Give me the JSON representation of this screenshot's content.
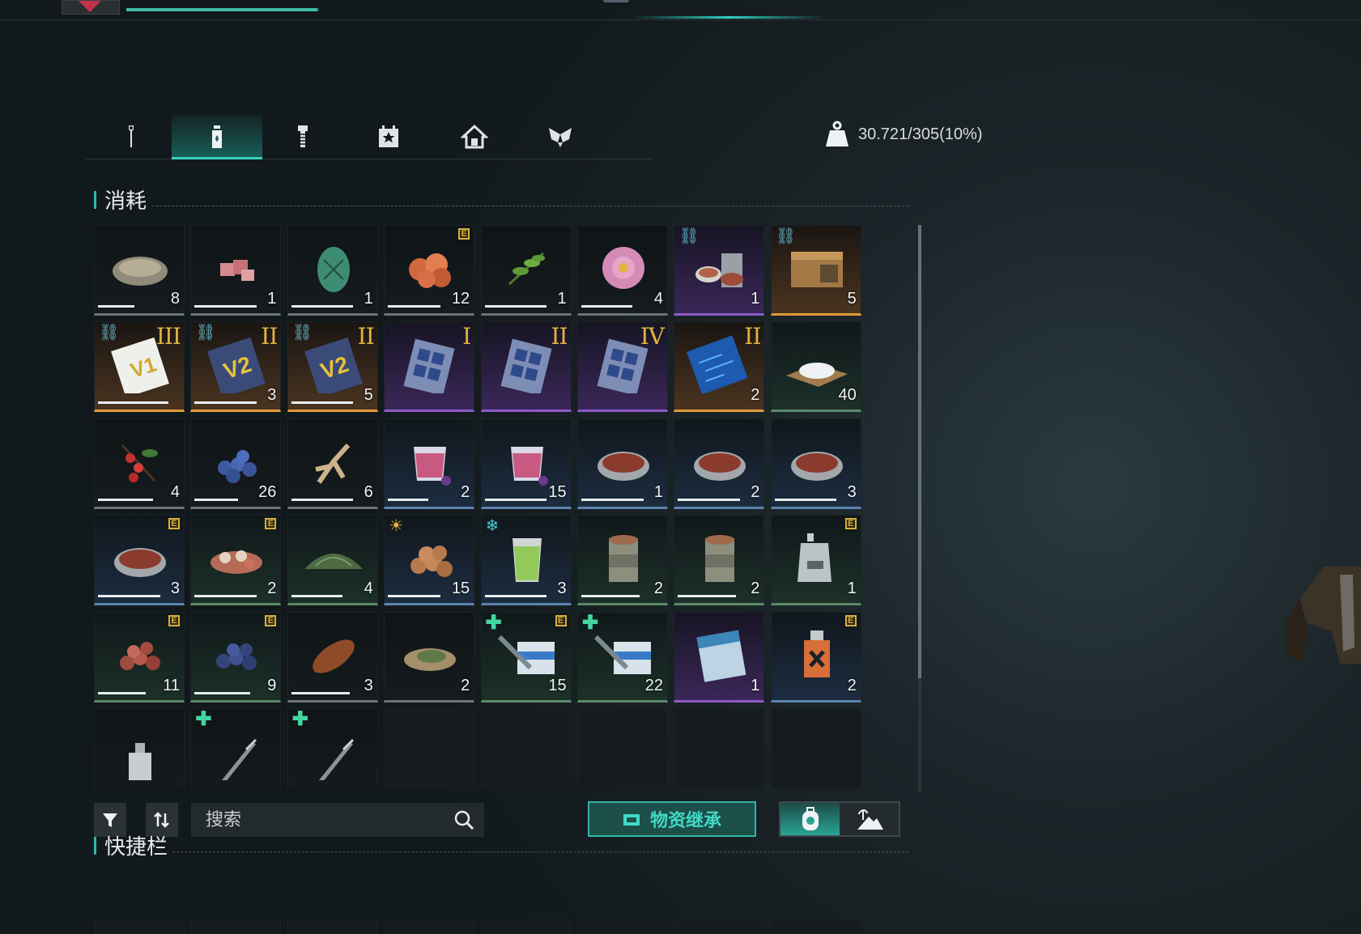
{
  "top": {
    "hp_fill": 0.99
  },
  "tabs": [
    {
      "name": "tools",
      "icon": "wrench-icon",
      "active": false
    },
    {
      "name": "consumables",
      "icon": "bottle-icon",
      "active": true
    },
    {
      "name": "materials",
      "icon": "bolt-icon",
      "active": false
    },
    {
      "name": "tasks",
      "icon": "star-box-icon",
      "active": false
    },
    {
      "name": "building",
      "icon": "house-icon",
      "active": false
    },
    {
      "name": "special",
      "icon": "wings-icon",
      "active": false
    }
  ],
  "weight": {
    "text": "30.721/305(10%)",
    "icon": "weight-icon"
  },
  "section_title": "消耗",
  "items": [
    {
      "icon": "oyster-icon",
      "count": "8",
      "quality": "gray",
      "dura": 0.5
    },
    {
      "icon": "raw-meat-icon",
      "count": "1",
      "quality": "gray",
      "dura": 0.85
    },
    {
      "icon": "melon-icon",
      "count": "1",
      "quality": "gray",
      "dura": 0.85
    },
    {
      "icon": "fruit-cluster-icon",
      "count": "12",
      "quality": "gray",
      "dura": 0.72,
      "badge": "E"
    },
    {
      "icon": "herb-icon",
      "count": "1",
      "quality": "gray",
      "dura": 0.85
    },
    {
      "icon": "flower-icon",
      "count": "4",
      "quality": "gray",
      "dura": 0.7
    },
    {
      "icon": "canned-meal-icon",
      "count": "1",
      "quality": "purple",
      "corner": "link"
    },
    {
      "icon": "supply-crate-icon",
      "count": "5",
      "quality": "orange",
      "corner": "link"
    },
    {
      "icon": "card-v1-icon",
      "count": "",
      "quality": "orange",
      "corner": "link",
      "roman": "III",
      "dura": 0.97
    },
    {
      "icon": "card-v2-icon",
      "count": "3",
      "quality": "orange",
      "corner": "link",
      "roman": "II",
      "dura": 0.85
    },
    {
      "icon": "card-v2-icon",
      "count": "5",
      "quality": "orange",
      "corner": "link",
      "roman": "II",
      "dura": 0.85
    },
    {
      "icon": "chip-pack-icon",
      "count": "",
      "quality": "purple",
      "roman": "I"
    },
    {
      "icon": "chip-pack-icon",
      "count": "",
      "quality": "purple",
      "roman": "II"
    },
    {
      "icon": "chip-pack-icon",
      "count": "",
      "quality": "purple",
      "roman": "IV"
    },
    {
      "icon": "circuit-board-icon",
      "count": "2",
      "quality": "orange",
      "roman": "II"
    },
    {
      "icon": "salt-pile-icon",
      "count": "40",
      "quality": "green"
    },
    {
      "icon": "berry-branch-icon",
      "count": "4",
      "quality": "gray",
      "dura": 0.75
    },
    {
      "icon": "blueberry-icon",
      "count": "26",
      "quality": "gray",
      "dura": 0.6
    },
    {
      "icon": "ginseng-icon",
      "count": "6",
      "quality": "gray",
      "dura": 0.85
    },
    {
      "icon": "berry-juice-icon",
      "count": "2",
      "quality": "blue",
      "dura": 0.55
    },
    {
      "icon": "berry-juice-icon",
      "count": "15",
      "quality": "blue",
      "dura": 0.85
    },
    {
      "icon": "meat-tin-icon",
      "count": "1",
      "quality": "blue",
      "dura": 0.85
    },
    {
      "icon": "meat-tin-icon",
      "count": "2",
      "quality": "blue",
      "dura": 0.85
    },
    {
      "icon": "meat-tin-icon",
      "count": "3",
      "quality": "blue",
      "dura": 0.85
    },
    {
      "icon": "meat-tin-icon",
      "count": "3",
      "quality": "blue",
      "dura": 0.85,
      "badge": "E"
    },
    {
      "icon": "mushroom-mix-icon",
      "count": "2",
      "quality": "green",
      "dura": 0.85,
      "badge": "E"
    },
    {
      "icon": "dried-herb-icon",
      "count": "4",
      "quality": "green",
      "dura": 0.7
    },
    {
      "icon": "potato-pile-icon",
      "count": "15",
      "quality": "blue",
      "dura": 0.72,
      "corner": "sun"
    },
    {
      "icon": "green-juice-icon",
      "count": "3",
      "quality": "blue",
      "dura": 0.85,
      "corner": "snow"
    },
    {
      "icon": "food-can-icon",
      "count": "2",
      "quality": "green",
      "dura": 0.8
    },
    {
      "icon": "food-can-icon",
      "count": "2",
      "quality": "green",
      "dura": 0.8
    },
    {
      "icon": "pouch-icon",
      "count": "1",
      "quality": "green",
      "badge": "E"
    },
    {
      "icon": "roasted-berries-icon",
      "count": "11",
      "quality": "green",
      "dura": 0.65,
      "badge": "E"
    },
    {
      "icon": "roasted-blueberries-icon",
      "count": "9",
      "quality": "green",
      "dura": 0.76,
      "badge": "E"
    },
    {
      "icon": "roast-meat-icon",
      "count": "3",
      "quality": "gray",
      "dura": 0.8
    },
    {
      "icon": "leaf-cake-icon",
      "count": "2",
      "quality": "gray"
    },
    {
      "icon": "syringe-kit-icon",
      "count": "15",
      "quality": "green",
      "corner": "plus",
      "badge": "E"
    },
    {
      "icon": "syringe-kit-icon",
      "count": "22",
      "quality": "green",
      "corner": "plus"
    },
    {
      "icon": "medkit-box-icon",
      "count": "1",
      "quality": "purple"
    },
    {
      "icon": "medicine-bottle-icon",
      "count": "2",
      "quality": "blue",
      "badge": "E"
    },
    {
      "icon": "spray-bottle-icon",
      "count": "",
      "quality": "empty-item"
    },
    {
      "icon": "injector-icon",
      "count": "",
      "quality": "empty-item",
      "corner": "plus"
    },
    {
      "icon": "injector-icon",
      "count": "",
      "quality": "empty-item",
      "corner": "plus"
    },
    {
      "icon": "",
      "count": "",
      "quality": "empty"
    },
    {
      "icon": "",
      "count": "",
      "quality": "empty"
    },
    {
      "icon": "",
      "count": "",
      "quality": "empty"
    },
    {
      "icon": "",
      "count": "",
      "quality": "empty"
    },
    {
      "icon": "",
      "count": "",
      "quality": "empty"
    }
  ],
  "toolbar": {
    "filter_icon": "filter-icon",
    "sort_icon": "sort-icon",
    "search_placeholder": "搜索",
    "inherit_label": "物资继承",
    "seg_left_icon": "backpack-icon",
    "seg_right_icon": "island-icon"
  },
  "hotbar_title": "快捷栏",
  "colors": {
    "accent": "#35d0bd",
    "gold": "#e1b23f",
    "purple": "#8c5ac8",
    "orange": "#e09a3a"
  }
}
